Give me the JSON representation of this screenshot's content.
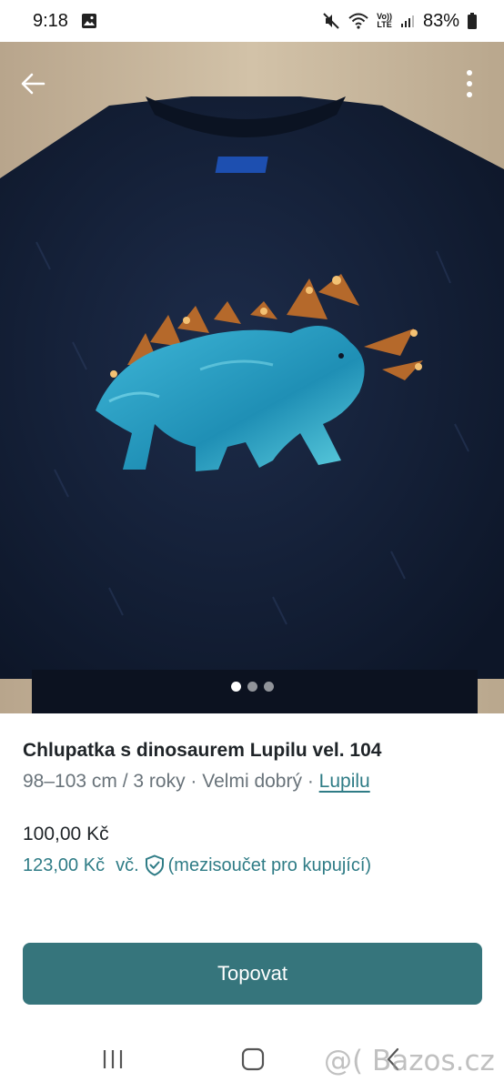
{
  "status_bar": {
    "time": "9:18",
    "battery_percent": "83%",
    "network_label_top": "Vo))",
    "network_label_bottom": "LTE",
    "icons": [
      "image-icon",
      "mute-icon",
      "wifi-icon",
      "signal-icon",
      "battery-icon"
    ]
  },
  "gallery": {
    "image_count": 3,
    "active_index": 0,
    "icons": {
      "back": "arrow-left-icon",
      "more": "more-vert-icon"
    }
  },
  "item": {
    "title": "Chlupatka s dinosaurem Lupilu vel. 104",
    "size": "98–103 cm / 3 roky",
    "separator": " · ",
    "condition": "Velmi dobrý",
    "brand": "Lupilu",
    "price": "100,00 Kč",
    "buyer_price": "123,00 Kč",
    "buyer_price_prefix": "vč.",
    "buyer_price_note": "(mezisoučet pro kupující)"
  },
  "actions": {
    "bump_label": "Topovat"
  },
  "watermark": {
    "text": "@( Bazos.cz"
  },
  "colors": {
    "accent": "#36757c",
    "link": "#2f7c86",
    "muted_text": "#69737a"
  }
}
